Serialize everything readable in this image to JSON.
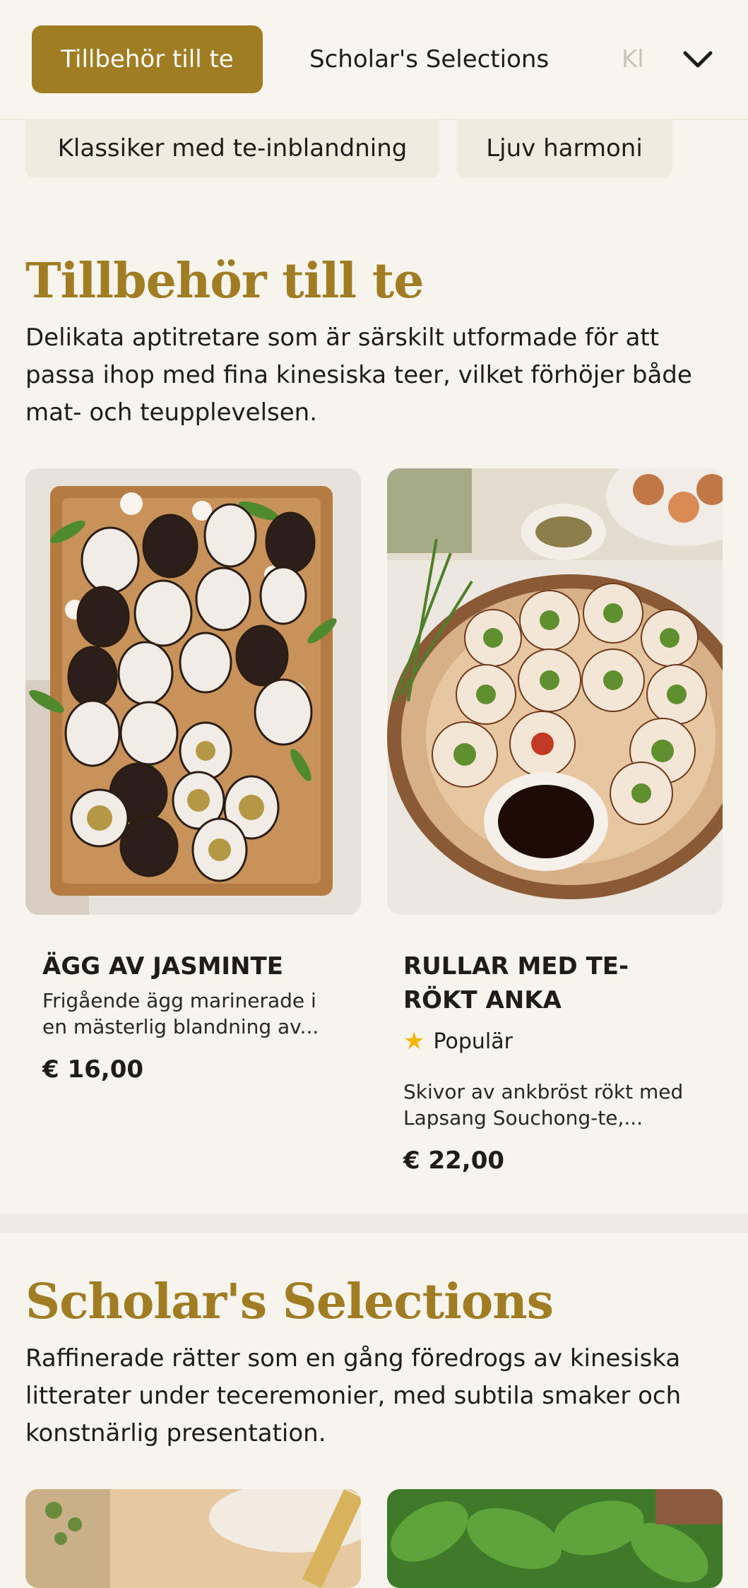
{
  "tabs": {
    "active": "Tillbehör till te",
    "second": "Scholar's Selections",
    "third_partial": "Kl"
  },
  "chips": [
    "Klassiker med te-inblandning",
    "Ljuv harmoni"
  ],
  "sections": [
    {
      "title": "Tillbehör till te",
      "description": "Delikata aptitretare som är särskilt utformade för att passa ihop med fina kinesiska teer, vilket förhöjer både mat- och teupplevelsen.",
      "items": [
        {
          "name": "ÄGG AV JASMINTE",
          "description": "Frigående ägg marinerade i en mästerlig blandning av...",
          "price": "€ 16,00",
          "badge": ""
        },
        {
          "name": "RULLAR MED TE-RÖKT ANKA",
          "description": "Skivor av ankbröst rökt med Lapsang Souchong-te,...",
          "price": "€ 22,00",
          "badge": "Populär"
        }
      ]
    },
    {
      "title": "Scholar's Selections",
      "description": "Raffinerade rätter som en gång föredrogs av kinesiska litterater under teceremonier, med subtila smaker och konstnärlig presentation."
    }
  ],
  "icons": {
    "chevron": "chevron-down-icon",
    "star": "star-icon"
  },
  "colors": {
    "accent": "#a07c22",
    "background": "#f7f4ee",
    "chip": "#efebe0",
    "star": "#f2b707"
  }
}
